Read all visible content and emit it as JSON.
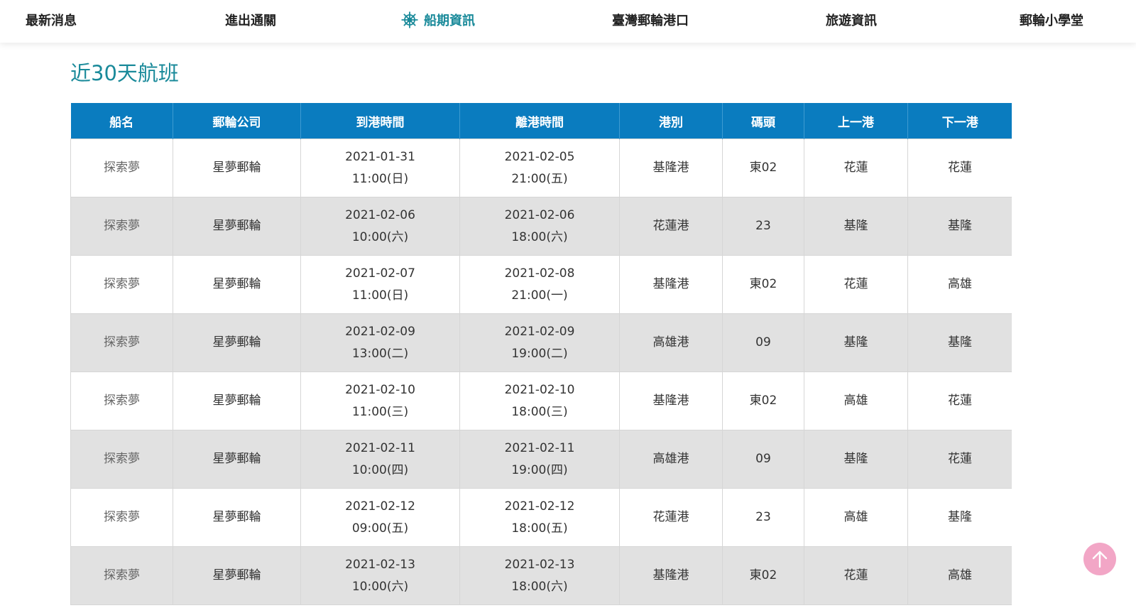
{
  "nav": {
    "items": [
      {
        "label": "最新消息"
      },
      {
        "label": "進出通關"
      },
      {
        "label": "船期資訊",
        "active": true,
        "icon": "ship-wheel-icon"
      },
      {
        "label": "臺灣郵輪港口"
      },
      {
        "label": "旅遊資訊"
      },
      {
        "label": "郵輪小學堂"
      }
    ]
  },
  "page": {
    "title": "近30天航班"
  },
  "table": {
    "headers": [
      "船名",
      "郵輪公司",
      "到港時間",
      "離港時間",
      "港別",
      "碼頭",
      "上一港",
      "下一港"
    ],
    "rows": [
      {
        "ship": "探索夢",
        "company": "星夢郵輪",
        "arrive_date": "2021-01-31",
        "arrive_time": "11:00(日)",
        "depart_date": "2021-02-05",
        "depart_time": "21:00(五)",
        "port": "基隆港",
        "pier": "東02",
        "prev_port": "花蓮",
        "next_port": "花蓮"
      },
      {
        "ship": "探索夢",
        "company": "星夢郵輪",
        "arrive_date": "2021-02-06",
        "arrive_time": "10:00(六)",
        "depart_date": "2021-02-06",
        "depart_time": "18:00(六)",
        "port": "花蓮港",
        "pier": "23",
        "prev_port": "基隆",
        "next_port": "基隆"
      },
      {
        "ship": "探索夢",
        "company": "星夢郵輪",
        "arrive_date": "2021-02-07",
        "arrive_time": "11:00(日)",
        "depart_date": "2021-02-08",
        "depart_time": "21:00(一)",
        "port": "基隆港",
        "pier": "東02",
        "prev_port": "花蓮",
        "next_port": "高雄"
      },
      {
        "ship": "探索夢",
        "company": "星夢郵輪",
        "arrive_date": "2021-02-09",
        "arrive_time": "13:00(二)",
        "depart_date": "2021-02-09",
        "depart_time": "19:00(二)",
        "port": "高雄港",
        "pier": "09",
        "prev_port": "基隆",
        "next_port": "基隆"
      },
      {
        "ship": "探索夢",
        "company": "星夢郵輪",
        "arrive_date": "2021-02-10",
        "arrive_time": "11:00(三)",
        "depart_date": "2021-02-10",
        "depart_time": "18:00(三)",
        "port": "基隆港",
        "pier": "東02",
        "prev_port": "高雄",
        "next_port": "花蓮"
      },
      {
        "ship": "探索夢",
        "company": "星夢郵輪",
        "arrive_date": "2021-02-11",
        "arrive_time": "10:00(四)",
        "depart_date": "2021-02-11",
        "depart_time": "19:00(四)",
        "port": "高雄港",
        "pier": "09",
        "prev_port": "基隆",
        "next_port": "花蓮"
      },
      {
        "ship": "探索夢",
        "company": "星夢郵輪",
        "arrive_date": "2021-02-12",
        "arrive_time": "09:00(五)",
        "depart_date": "2021-02-12",
        "depart_time": "18:00(五)",
        "port": "花蓮港",
        "pier": "23",
        "prev_port": "高雄",
        "next_port": "基隆"
      },
      {
        "ship": "探索夢",
        "company": "星夢郵輪",
        "arrive_date": "2021-02-13",
        "arrive_time": "10:00(六)",
        "depart_date": "2021-02-13",
        "depart_time": "18:00(六)",
        "port": "基隆港",
        "pier": "東02",
        "prev_port": "花蓮",
        "next_port": "高雄"
      }
    ]
  },
  "colors": {
    "accent": "#1a8a9a",
    "table_header": "#0a7cbf",
    "row_alt": "#e1e1e1",
    "scroll_top": "#f2a6c6"
  },
  "scroll_top": {
    "icon": "arrow-up-icon"
  }
}
